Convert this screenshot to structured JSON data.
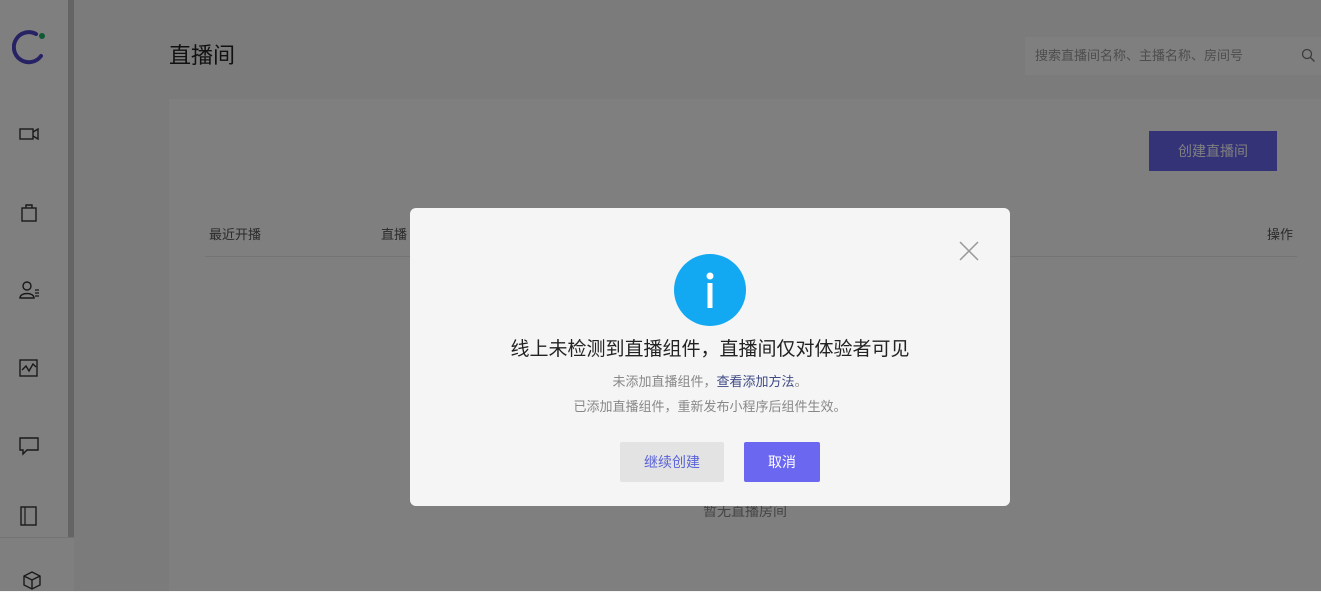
{
  "header": {
    "title": "直播间",
    "search": {
      "placeholder": "搜索直播间名称、主播名称、房间号",
      "value": ""
    }
  },
  "toolbar": {
    "create_label": "创建直播间"
  },
  "table": {
    "columns": [
      "最近开播",
      "直播",
      "操作"
    ],
    "empty_text": "暂无直播房间"
  },
  "sidebar": {
    "items": [
      {
        "icon": "video-camera-icon"
      },
      {
        "icon": "shopping-bag-icon"
      },
      {
        "icon": "user-list-icon"
      },
      {
        "icon": "chart-icon"
      },
      {
        "icon": "message-icon"
      },
      {
        "icon": "book-icon"
      },
      {
        "icon": "cube-icon"
      }
    ]
  },
  "dialog": {
    "icon": "info-icon",
    "title": "线上未检测到直播组件，直播间仅对体验者可见",
    "line1_prefix": "未添加直播组件，",
    "line1_link": "查看添加方法",
    "line1_suffix": "。",
    "line2": "已添加直播组件，重新发布小程序后组件生效。",
    "continue_label": "继续创建",
    "cancel_label": "取消"
  },
  "colors": {
    "accent": "#6b67f0",
    "info": "#12a8f2",
    "link": "#3e4a85"
  }
}
